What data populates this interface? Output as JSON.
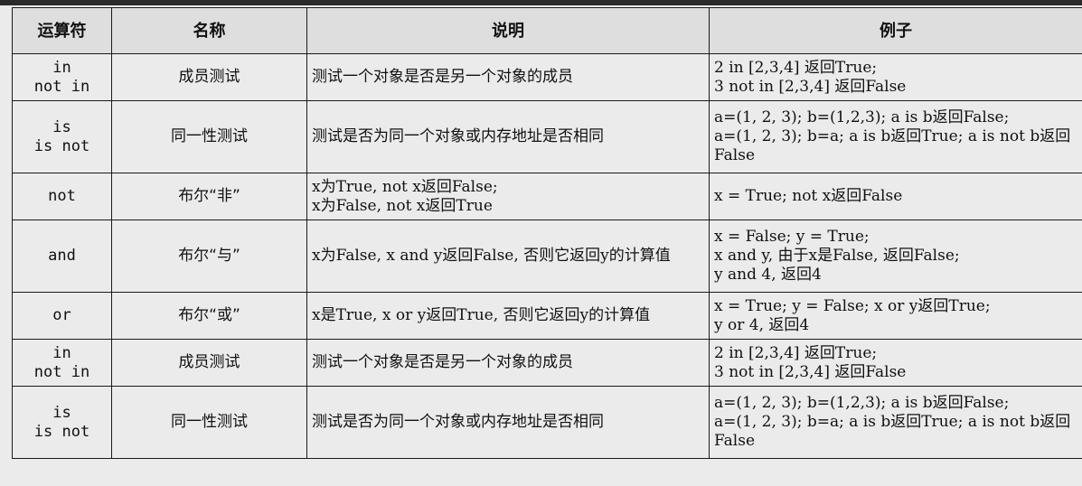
{
  "headers": [
    "运算符",
    "名称",
    "说明",
    "例子"
  ],
  "rows": [
    {
      "op": [
        "in",
        "not in"
      ],
      "name": "成员测试",
      "desc": [
        "测试一个对象是否是另一个对象的成员"
      ],
      "example": [
        "2 in [2,3,4] 返回True;",
        "3 not in [2,3,4] 返回False"
      ]
    },
    {
      "op": [
        "is",
        "is not"
      ],
      "name": "同一性测试",
      "desc": [
        "测试是否为同一个对象或内存地址是否相同"
      ],
      "example": [
        "a=(1, 2, 3); b=(1,2,3); a is b返回False;",
        "a=(1, 2, 3); b=a; a is b返回True; a is not b返回False"
      ]
    },
    {
      "op": [
        "not"
      ],
      "name": "布尔“非”",
      "desc": [
        "x为True, not x返回False;",
        "x为False, not x返回True"
      ],
      "example": [
        "x = True; not x返回False"
      ]
    },
    {
      "op": [
        "and"
      ],
      "name": "布尔“与”",
      "desc": [
        "x为False, x and y返回False, 否则它返回y的计算值"
      ],
      "example": [
        "x = False; y = True;",
        "x and y, 由于x是False, 返回False;",
        "y and 4, 返回4"
      ]
    },
    {
      "op": [
        "or"
      ],
      "name": "布尔“或”",
      "desc": [
        "x是True, x or y返回True, 否则它返回y的计算值"
      ],
      "example": [
        "x = True; y = False; x or y返回True;",
        "y or 4, 返回4"
      ]
    },
    {
      "op": [
        "in",
        "not in"
      ],
      "name": "成员测试",
      "desc": [
        "测试一个对象是否是另一个对象的成员"
      ],
      "example": [
        "2 in [2,3,4] 返回True;",
        "3 not in [2,3,4] 返回False"
      ]
    },
    {
      "op": [
        "is",
        "is not"
      ],
      "name": "同一性测试",
      "desc": [
        "测试是否为同一个对象或内存地址是否相同"
      ],
      "example": [
        "a=(1, 2, 3); b=(1,2,3); a is b返回False;",
        "a=(1, 2, 3); b=a; a is b返回True; a is not b返回False"
      ]
    }
  ]
}
